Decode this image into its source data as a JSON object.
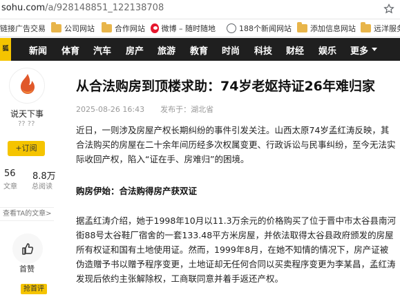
{
  "browser": {
    "url_host": "sohu.com",
    "url_path": "/a/928148851_122138708"
  },
  "bookmarks": [
    {
      "label": "链接广告交易",
      "icon": "none"
    },
    {
      "label": "公司网站",
      "icon": "folder-icon"
    },
    {
      "label": "合作网站",
      "icon": "folder-icon"
    },
    {
      "label": "微博 – 随时随地",
      "icon": "weibo-icon"
    },
    {
      "label": "188个新闻网站",
      "icon": "globe-icon"
    },
    {
      "label": "添加信息网站",
      "icon": "folder-icon"
    },
    {
      "label": "远洋服务",
      "icon": "folder-icon"
    }
  ],
  "nav": {
    "logo": "狐",
    "items": [
      "新闻",
      "体育",
      "汽车",
      "房产",
      "旅游",
      "教育",
      "时尚",
      "科技",
      "财经",
      "娱乐",
      "更多"
    ]
  },
  "sidebar": {
    "author": "说天下事",
    "badges": "?? ??",
    "follow_label": "+订阅",
    "stats": [
      {
        "value": "56",
        "label": "文章"
      },
      {
        "value": "8.8万",
        "label": "总阅读"
      }
    ],
    "other_articles": "查看TA的文章>",
    "like_label": "首赞",
    "tag_label": "抢首评"
  },
  "article": {
    "title": "从合法购房到顶楼求助：74岁老妪持证26年难归家",
    "date": "2025-08-26 16:43",
    "source": "发布于：湖北省",
    "paragraphs": [
      "近日，一则涉及房屋产权长期纠纷的事件引发关注。山西太原74岁孟红涛反映，其合法购买的房屋在二十余年间历经多次权属变更、行政诉讼与民事纠纷，至今无法实际收回产权，陷入“证在手、房难归”的困境。",
      "据孟红涛介绍，她于1998年10月以11.3万余元的价格购买了位于晋中市太谷县南河街88号太谷鞋厂宿舍的一套133.48平方米房屋，并依法取得太谷县政府颁发的房屋所有权证和国有土地使用证。然而，1999年8月，在她不知情的情况下，房产证被伪造赠予书以赠予程序变更，土地证却无任何合同以买卖程序变更为李某昌，孟红涛发现后依约主张解除权，工商联同意并着手返还产权。"
    ],
    "subheading": "购房伊始：合法购得房产获双证"
  }
}
